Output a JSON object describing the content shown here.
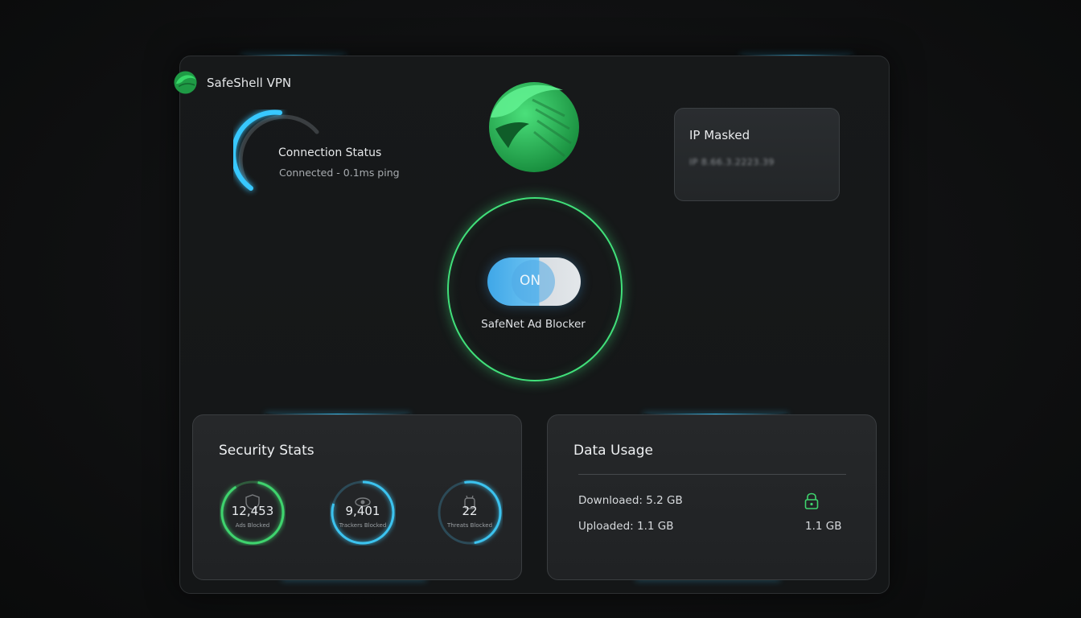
{
  "app": {
    "name": "SafeShell VPN"
  },
  "connection": {
    "title": "Connection Status",
    "status": "Connected - 0.1ms ping"
  },
  "ip": {
    "title": "IP Masked",
    "value": "IP 8.66.3.2223.39"
  },
  "ad_blocker": {
    "state": "ON",
    "label": "SafeNet Ad Blocker"
  },
  "security_stats": {
    "title": "Security Stats",
    "items": [
      {
        "value": "12,453",
        "label": "Ads Blocked",
        "icon": "shield-icon",
        "color": "#3fd46e"
      },
      {
        "value": "9,401",
        "label": "Trackers Blocked",
        "icon": "eye-icon",
        "color": "#3cc3ef"
      },
      {
        "value": "22",
        "label": "Threats Blocked",
        "icon": "bug-icon",
        "color": "#3cc3ef"
      }
    ]
  },
  "data_usage": {
    "title": "Data Usage",
    "downloaded": "Downloaed: 5.2 GB",
    "uploaded": "Uploaded: 1.1 GB",
    "uploaded_right": "1.1 GB",
    "icon": "lock-icon"
  },
  "colors": {
    "accent_green": "#41e07a",
    "accent_blue": "#38c8ff"
  }
}
